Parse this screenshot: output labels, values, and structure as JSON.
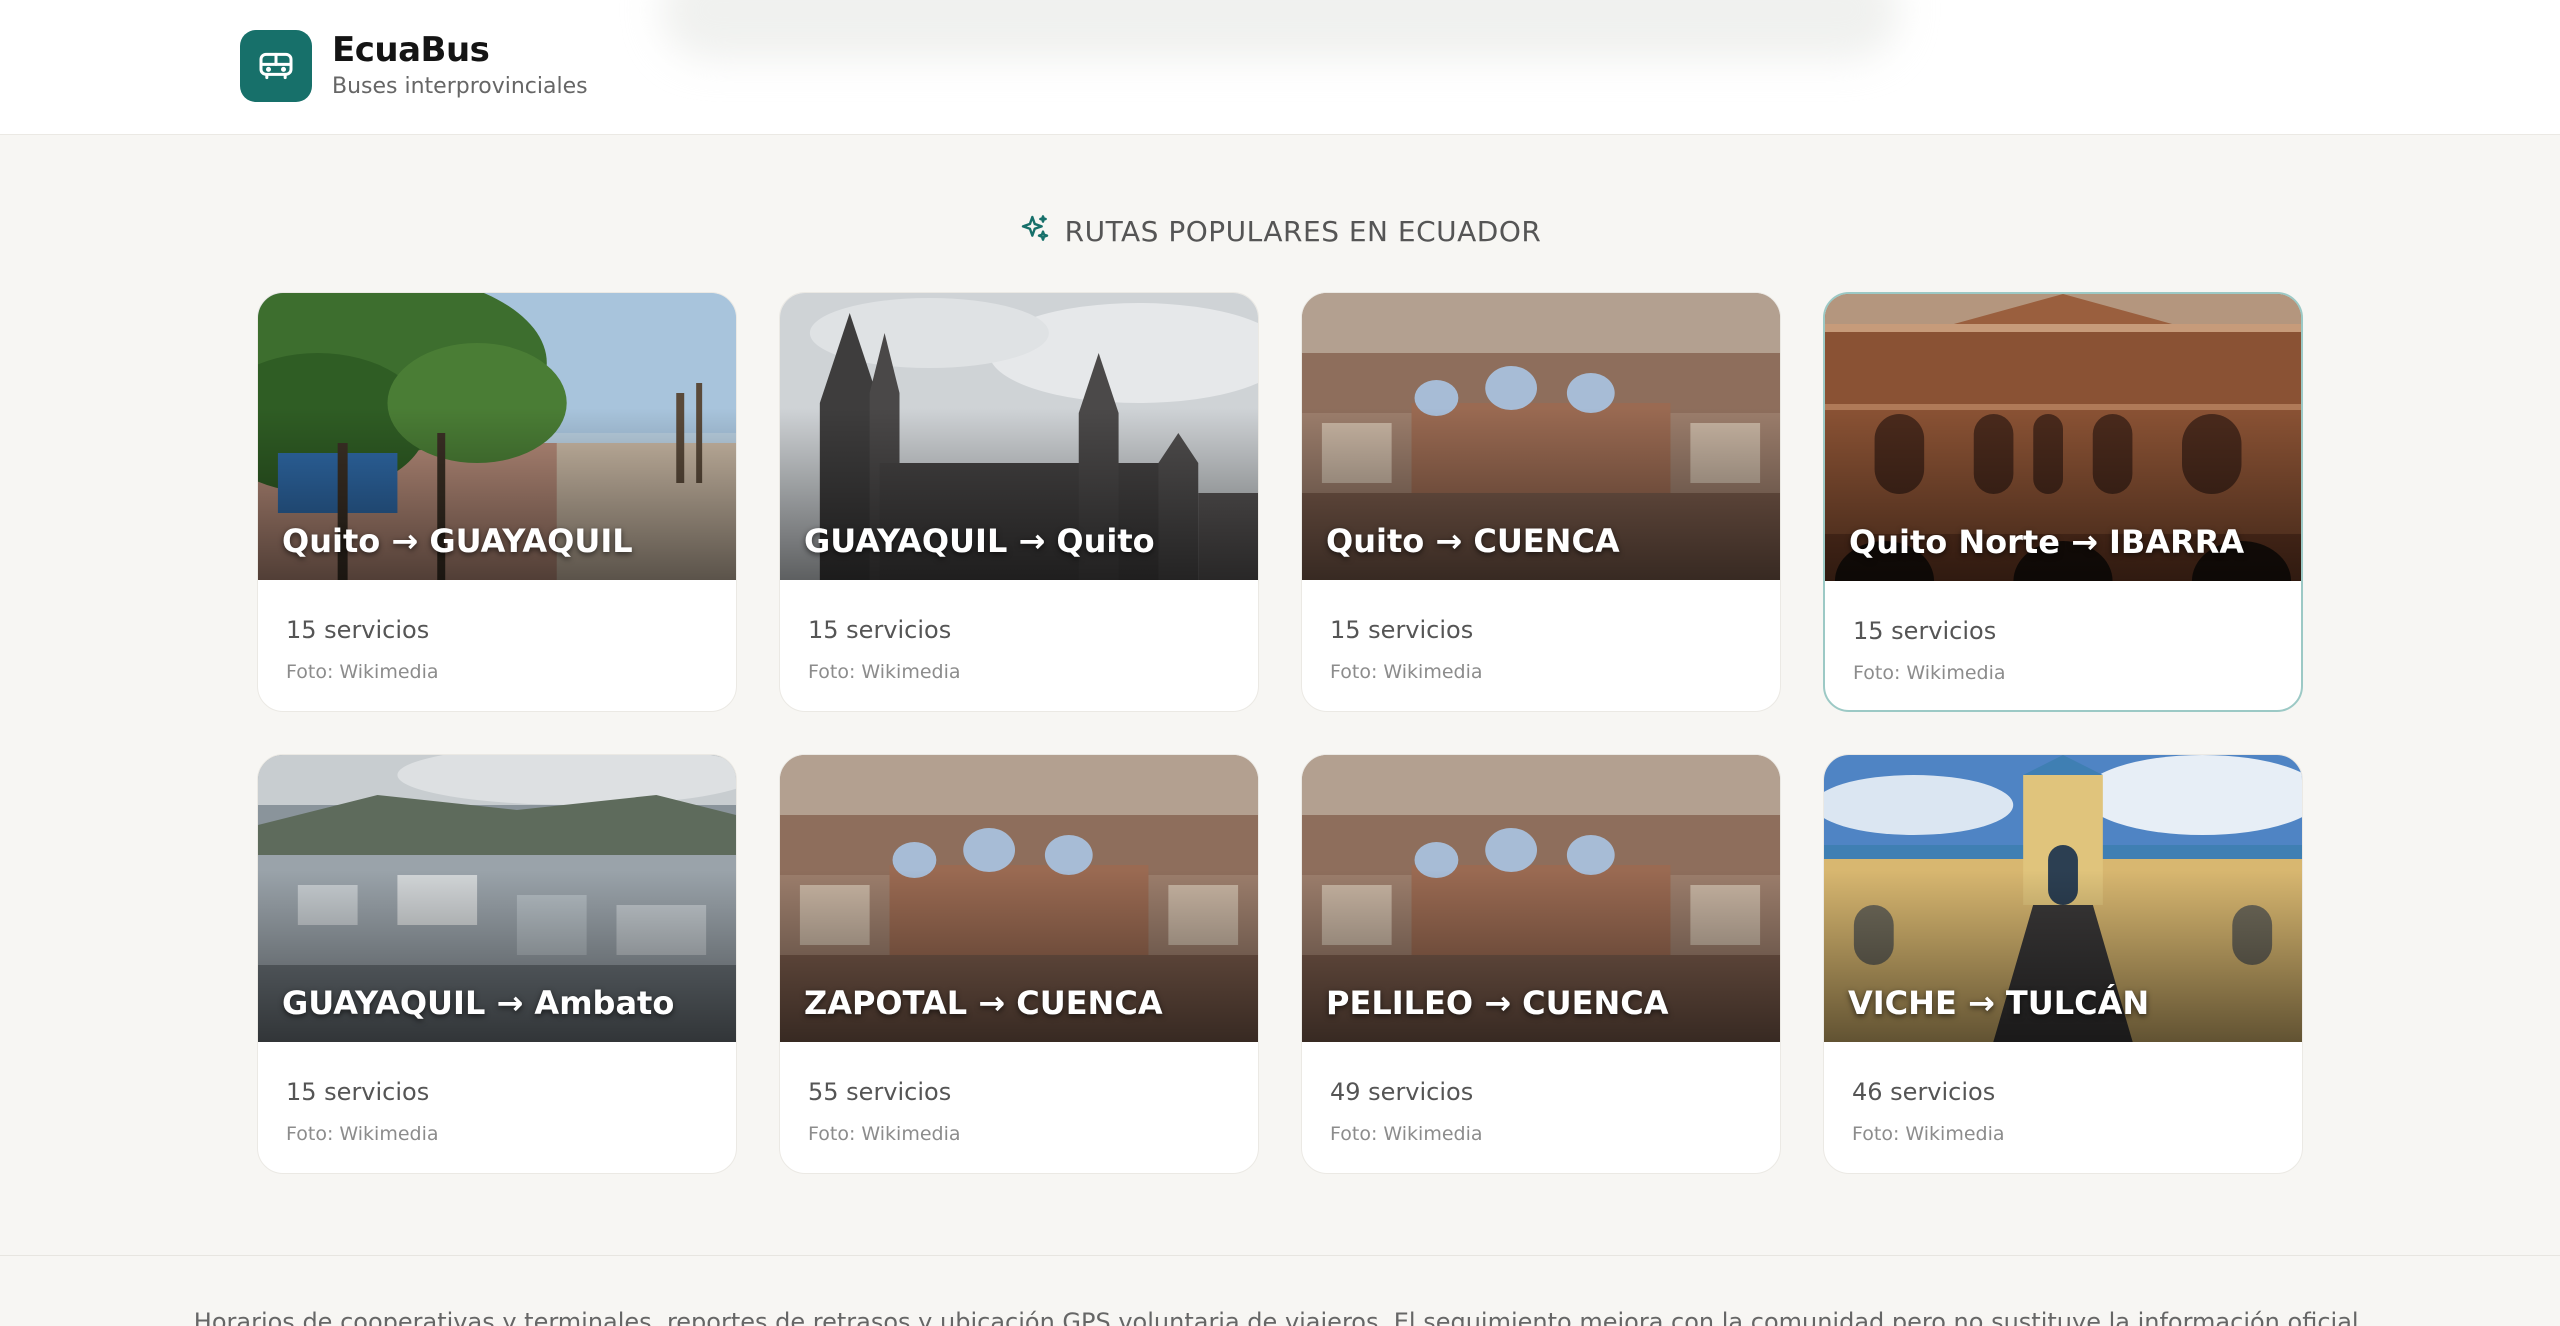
{
  "brand": {
    "title": "EcuaBus",
    "subtitle": "Buses interprovinciales",
    "icon": "bus-icon",
    "color": "#17706a"
  },
  "section": {
    "title": "RUTAS POPULARES EN ECUADOR",
    "icon": "sparkle-icon"
  },
  "routes": [
    {
      "title": "Quito → GUAYAQUIL",
      "count": "15 servicios",
      "credit": "Foto: Wikimedia"
    },
    {
      "title": "GUAYAQUIL → Quito",
      "count": "15 servicios",
      "credit": "Foto: Wikimedia"
    },
    {
      "title": "Quito → CUENCA",
      "count": "15 servicios",
      "credit": "Foto: Wikimedia"
    },
    {
      "title": "Quito Norte → IBARRA",
      "count": "15 servicios",
      "credit": "Foto: Wikimedia"
    },
    {
      "title": "GUAYAQUIL → Ambato",
      "count": "15 servicios",
      "credit": "Foto: Wikimedia"
    },
    {
      "title": "ZAPOTAL → CUENCA",
      "count": "55 servicios",
      "credit": "Foto: Wikimedia"
    },
    {
      "title": "PELILEO → CUENCA",
      "count": "49 servicios",
      "credit": "Foto: Wikimedia"
    },
    {
      "title": "VICHE → TULCÁN",
      "count": "46 servicios",
      "credit": "Foto: Wikimedia"
    }
  ],
  "footer": {
    "text": "Horarios de cooperativas y terminales, reportes de retrasos y ubicación GPS voluntaria de viajeros. El seguimiento mejora con la comunidad pero no sustituye la información oficial."
  }
}
